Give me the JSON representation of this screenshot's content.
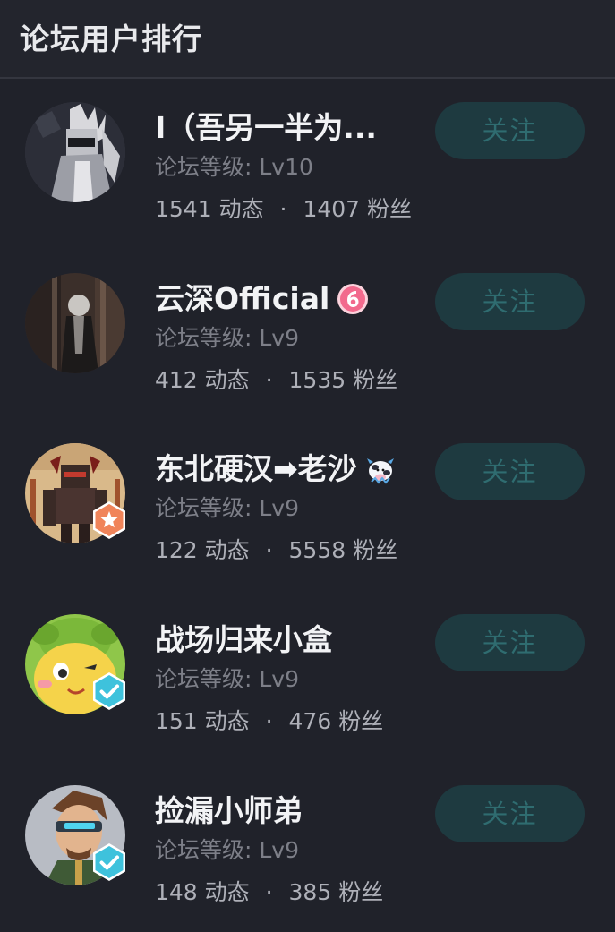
{
  "header": {
    "title": "论坛用户排行"
  },
  "users": [
    {
      "name": "I（吾另一半为...",
      "level": "论坛等级: Lv10",
      "posts": "1541 动态",
      "separator": "·",
      "fans": "1407 粉丝",
      "follow_label": "关注",
      "badge": null,
      "name_badge": null
    },
    {
      "name": "云深Official",
      "level": "论坛等级: Lv9",
      "posts": "412 动态",
      "separator": "·",
      "fans": "1535 粉丝",
      "follow_label": "关注",
      "badge": null,
      "name_badge": "level-6-icon"
    },
    {
      "name": "东北硬汉➡老沙",
      "level": "论坛等级: Lv9",
      "posts": "122 动态",
      "separator": "·",
      "fans": "5558 粉丝",
      "follow_label": "关注",
      "badge": "star-badge-icon",
      "name_badge": "cow-emoji-icon"
    },
    {
      "name": "战场归来小盒",
      "level": "论坛等级: Lv9",
      "posts": "151 动态",
      "separator": "·",
      "fans": "476 粉丝",
      "follow_label": "关注",
      "badge": "verified-check-icon",
      "name_badge": null
    },
    {
      "name": "捡漏小师弟",
      "level": "论坛等级: Lv9",
      "posts": "148 动态",
      "separator": "·",
      "fans": "385 粉丝",
      "follow_label": "关注",
      "badge": "verified-check-icon",
      "name_badge": null
    }
  ],
  "colors": {
    "background": "#20222a",
    "follow_button_bg": "#1e3a40",
    "follow_button_text": "#2f6c70",
    "star_badge": "#f0845a",
    "verified_badge": "#3ec2dc",
    "level_badge": "#f26a8d"
  }
}
